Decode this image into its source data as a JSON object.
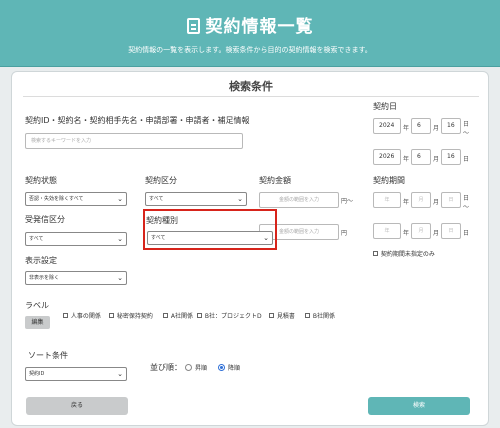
{
  "header": {
    "title": "契約情報一覧",
    "subtitle": "契約情報の一覧を表示します。検索条件から目的の契約情報を検索できます。"
  },
  "search": {
    "section_title": "検索条件",
    "keyword": {
      "label": "契約ID・契約名・契約相手先名・申請部署・申請者・補足情報",
      "placeholder": "検索するキーワードを入力"
    },
    "contract_date": {
      "label": "契約日",
      "from": {
        "year": "2024",
        "month": "6",
        "day": "16"
      },
      "to": {
        "year": "2026",
        "month": "6",
        "day": "16"
      },
      "unit_year": "年",
      "unit_month": "月",
      "unit_day": "日",
      "tilde": "～"
    },
    "contract_status": {
      "label": "契約状態",
      "selected": "否認・失効を除くすべて"
    },
    "contract_category": {
      "label": "契約区分",
      "selected": "すべて"
    },
    "contract_amount": {
      "label": "契約金額",
      "placeholder": "金額の範囲を入力",
      "unit": "円",
      "tilde": "～"
    },
    "contract_period": {
      "label": "契約期間",
      "ph_year": "年",
      "ph_month": "月",
      "ph_day": "日",
      "unit_year": "年",
      "unit_month": "月",
      "unit_day": "日",
      "tilde": "～",
      "unspecified_label": "契約期間未指定のみ"
    },
    "send_receive": {
      "label": "受発信区分",
      "selected": "すべて"
    },
    "contract_type": {
      "label": "契約種別",
      "selected": "すべて"
    },
    "display": {
      "label": "表示設定",
      "selected": "非表示を除く"
    },
    "labels": {
      "label": "ラベル",
      "edit_button": "編集",
      "items": [
        "人事の関係",
        "秘密保持契約",
        "A社関係",
        "B社：プロジェクトD",
        "見積書",
        "B社関係"
      ]
    },
    "sort": {
      "label": "ソート条件",
      "selected": "契約ID",
      "order_label": "並び順：",
      "asc": "昇順",
      "desc": "降順",
      "selected_order": "desc"
    },
    "back_button": "戻る",
    "search_button": "検索"
  },
  "colors": {
    "accent": "#5fb6b6",
    "highlight": "#d7241b",
    "radio": "#2f6fd6"
  }
}
